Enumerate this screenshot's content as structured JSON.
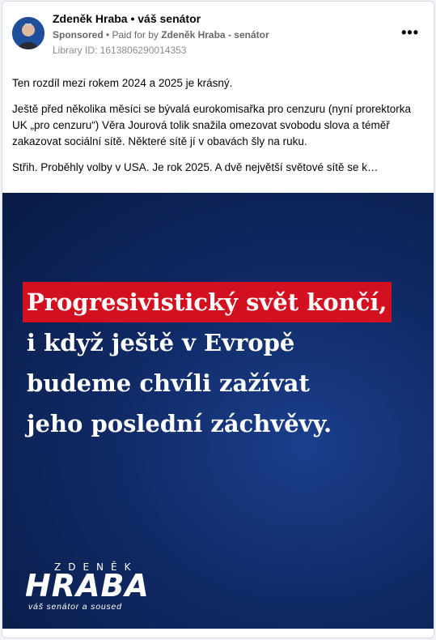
{
  "header": {
    "page_name": "Zdeněk Hraba • váš senátor",
    "sponsored_label": "Sponsored",
    "paid_for_prefix": " • Paid for by ",
    "payer": "Zdeněk Hraba - senátor",
    "library_id": "Library ID: 1613806290014353",
    "more_icon": "ellipsis-icon"
  },
  "post": {
    "paragraphs": [
      "Ten rozdíl mezi rokem 2024 a 2025 je krásný.",
      "Ještě před několika měsíci se bývalá eurokomisařka pro cenzuru (nyní prorektorka UK „pro cenzuru“) Věra Jourová tolik snažila omezovat svobodu slova a téměř zakazovat sociální sítě. Některé sítě jí v obavách šly na ruku.",
      "Střih. Proběhly volby v USA. Je rok 2025. A dvě největší světové sítě se k…"
    ]
  },
  "creative": {
    "lines": [
      "Progresivistický svět končí,",
      "i když ještě v Evropě",
      "budeme chvíli zažívat",
      "jeho poslední záchvěvy."
    ],
    "brand_first": "ZDENĚK",
    "brand_last": "HRABA",
    "brand_tagline": "váš senátor a soused",
    "colors": {
      "background": "#0f2a66",
      "highlight": "#d3101f",
      "text": "#ffffff"
    }
  }
}
